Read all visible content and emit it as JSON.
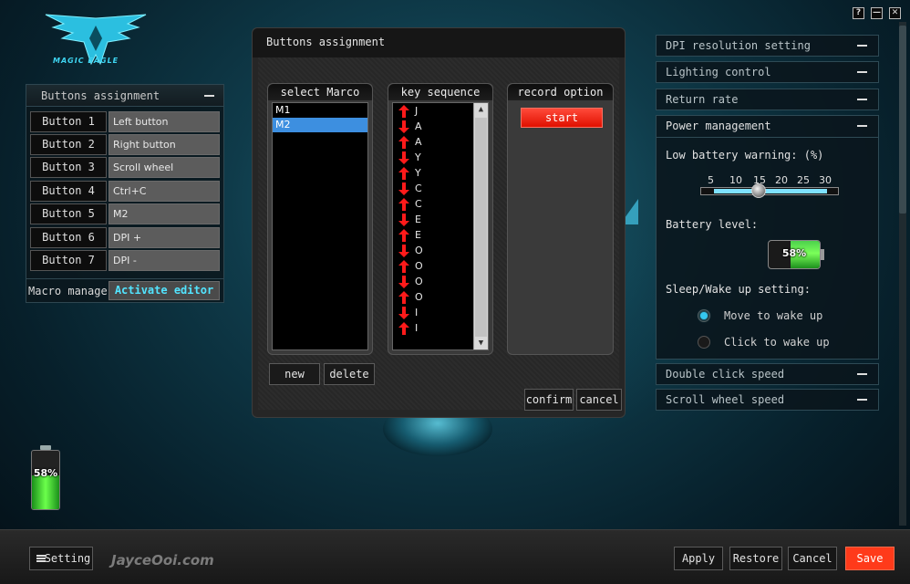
{
  "brand": {
    "logo_text": "MAGIC EAGLE"
  },
  "window_controls": {
    "help": "?",
    "minimize": "—",
    "close": "✕"
  },
  "left_panel": {
    "title": "Buttons assignment",
    "buttons": [
      {
        "name": "Button 1",
        "value": "Left button"
      },
      {
        "name": "Button 2",
        "value": "Right button"
      },
      {
        "name": "Button 3",
        "value": "Scroll wheel"
      },
      {
        "name": "Button 4",
        "value": "Ctrl+C"
      },
      {
        "name": "Button 5",
        "value": "M2"
      },
      {
        "name": "Button 6",
        "value": "DPI +"
      },
      {
        "name": "Button 7",
        "value": "DPI -"
      }
    ],
    "macro_manager_label": "Macro manager",
    "activate_editor_label": "Activate editor"
  },
  "battery_left": {
    "percent_label": "58%",
    "level": 0.58
  },
  "dialog": {
    "title": "Buttons assignment",
    "select_macro": {
      "header": "select Marco",
      "items": [
        "M1",
        "M2"
      ],
      "selected": "M2"
    },
    "key_sequence": {
      "header": "key sequence",
      "items": [
        {
          "dir": "up",
          "key": "J"
        },
        {
          "dir": "down",
          "key": "A"
        },
        {
          "dir": "up",
          "key": "A"
        },
        {
          "dir": "down",
          "key": "Y"
        },
        {
          "dir": "up",
          "key": "Y"
        },
        {
          "dir": "down",
          "key": "C"
        },
        {
          "dir": "up",
          "key": "C"
        },
        {
          "dir": "down",
          "key": "E"
        },
        {
          "dir": "up",
          "key": "E"
        },
        {
          "dir": "down",
          "key": "O"
        },
        {
          "dir": "up",
          "key": "O"
        },
        {
          "dir": "down",
          "key": "O"
        },
        {
          "dir": "up",
          "key": "O"
        },
        {
          "dir": "down",
          "key": "I"
        },
        {
          "dir": "up",
          "key": "I"
        }
      ]
    },
    "record_option": {
      "header": "record option",
      "start_label": "start"
    },
    "new_label": "new",
    "delete_label": "delete",
    "confirm_label": "confirm",
    "cancel_label": "cancel"
  },
  "right_panel": {
    "dpi": "DPI resolution setting",
    "lighting": "Lighting control",
    "return_rate": "Return rate",
    "power": {
      "title": "Power management",
      "low_battery_label": "Low battery warning: (%)",
      "ticks": [
        "5",
        "10",
        "15",
        "20",
        "25",
        "30"
      ],
      "selected_value": "15",
      "battery_level_label": "Battery level:",
      "battery_percent": "58%",
      "battery_level": 0.58,
      "sleep_label": "Sleep/Wake up setting:",
      "move_to_wake": "Move to wake up",
      "click_to_wake": "Click to wake up",
      "selected_wake": "Move to wake up"
    },
    "double_click": "Double click speed",
    "scroll_wheel": "Scroll wheel speed"
  },
  "bottom_bar": {
    "setting_label": "Setting",
    "watermark": "JayceOoi.com",
    "apply": "Apply",
    "restore": "Restore",
    "cancel": "Cancel",
    "save": "Save"
  },
  "colors": {
    "accent": "#35c8f0",
    "save": "#ff3a1a",
    "selection": "#3d8fe0",
    "arrow": "#ff1a1a"
  }
}
